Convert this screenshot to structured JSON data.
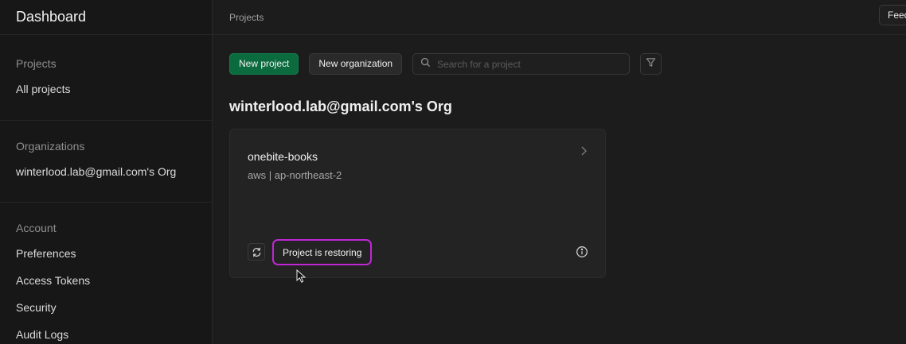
{
  "sidebar": {
    "title": "Dashboard",
    "projects_section": {
      "heading": "Projects",
      "items": [
        "All projects"
      ]
    },
    "orgs_section": {
      "heading": "Organizations",
      "items": [
        "winterlood.lab@gmail.com's Org"
      ]
    },
    "account_section": {
      "heading": "Account",
      "items": [
        "Preferences",
        "Access Tokens",
        "Security",
        "Audit Logs"
      ]
    }
  },
  "topbar": {
    "breadcrumb": "Projects",
    "feedback_label": "Feedback"
  },
  "actions": {
    "new_project_label": "New project",
    "new_org_label": "New organization",
    "search_placeholder": "Search for a project",
    "search_icon": "search-icon",
    "filter_icon": "filter-icon"
  },
  "org": {
    "title": "winterlood.lab@gmail.com's Org",
    "projects": [
      {
        "name": "onebite-books",
        "region": "aws | ap-northeast-2",
        "status": "Project is restoring",
        "status_icon": "restore-icon",
        "status_color": "#c026d3"
      }
    ]
  },
  "colors": {
    "accent": "#0b6b3e",
    "highlight": "#c026d3"
  }
}
